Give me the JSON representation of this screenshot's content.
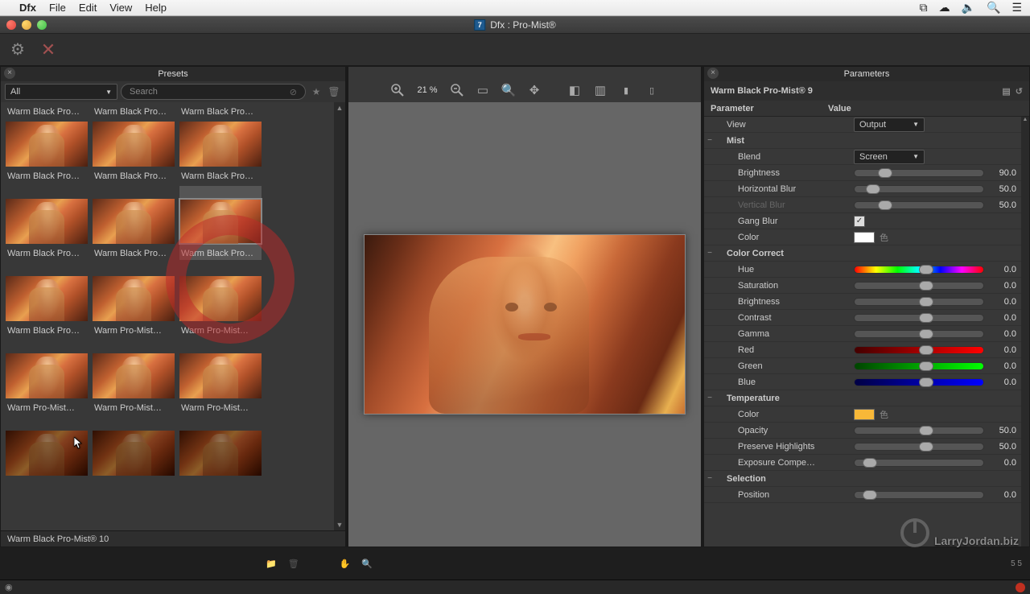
{
  "menubar": {
    "app": "Dfx",
    "items": [
      "File",
      "Edit",
      "View",
      "Help"
    ]
  },
  "window": {
    "title": "Dfx : Pro-Mist®"
  },
  "presets": {
    "title": "Presets",
    "filter_sel": "All",
    "search_placeholder": "Search",
    "items": [
      "Warm Black Pro…",
      "Warm Black Pro…",
      "Warm Black Pro…",
      "Warm Black Pro…",
      "Warm Black Pro…",
      "Warm Black Pro…",
      "Warm Black Pro…",
      "Warm Pro-Mist…",
      "Warm Pro-Mist…",
      "Warm Pro-Mist…",
      "Warm Pro-Mist…",
      "Warm Pro-Mist…",
      "",
      "",
      ""
    ],
    "selected_index": 5,
    "status": "Warm Black Pro-Mist® 10"
  },
  "viewer": {
    "zoom": "21 %"
  },
  "parameters": {
    "title": "Parameters",
    "preset_name": "Warm Black Pro-Mist® 9",
    "header": {
      "c1": "Parameter",
      "c2": "Value"
    },
    "view": {
      "label": "View",
      "value": "Output"
    },
    "mist": {
      "label": "Mist",
      "blend": {
        "label": "Blend",
        "value": "Screen"
      },
      "brightness": {
        "label": "Brightness",
        "value": "90.0",
        "pos": 0.18
      },
      "hblur": {
        "label": "Horizontal Blur",
        "value": "50.0",
        "pos": 0.09
      },
      "vblur": {
        "label": "Vertical Blur",
        "value": "50.0",
        "pos": 0.18,
        "disabled": true
      },
      "gang": {
        "label": "Gang Blur",
        "checked": true
      },
      "color": {
        "label": "Color",
        "swatch": "#ffffff"
      }
    },
    "cc": {
      "label": "Color Correct",
      "hue": {
        "label": "Hue",
        "value": "0.0",
        "pos": 0.5
      },
      "sat": {
        "label": "Saturation",
        "value": "0.0",
        "pos": 0.5
      },
      "bri": {
        "label": "Brightness",
        "value": "0.0",
        "pos": 0.5
      },
      "con": {
        "label": "Contrast",
        "value": "0.0",
        "pos": 0.5
      },
      "gam": {
        "label": "Gamma",
        "value": "0.0",
        "pos": 0.5
      },
      "red": {
        "label": "Red",
        "value": "0.0",
        "pos": 0.5
      },
      "grn": {
        "label": "Green",
        "value": "0.0",
        "pos": 0.5
      },
      "blu": {
        "label": "Blue",
        "value": "0.0",
        "pos": 0.5
      }
    },
    "temp": {
      "label": "Temperature",
      "color": {
        "label": "Color",
        "swatch": "#f8b838"
      },
      "opacity": {
        "label": "Opacity",
        "value": "50.0",
        "pos": 0.5
      },
      "preserve": {
        "label": "Preserve Highlights",
        "value": "50.0",
        "pos": 0.5
      },
      "exp": {
        "label": "Exposure Compe…",
        "value": "0.0",
        "pos": 0.06
      }
    },
    "selection": {
      "label": "Selection",
      "position": {
        "label": "Position",
        "value": "0.0",
        "pos": 0.06
      }
    }
  },
  "watermark": "LarryJordan.biz"
}
